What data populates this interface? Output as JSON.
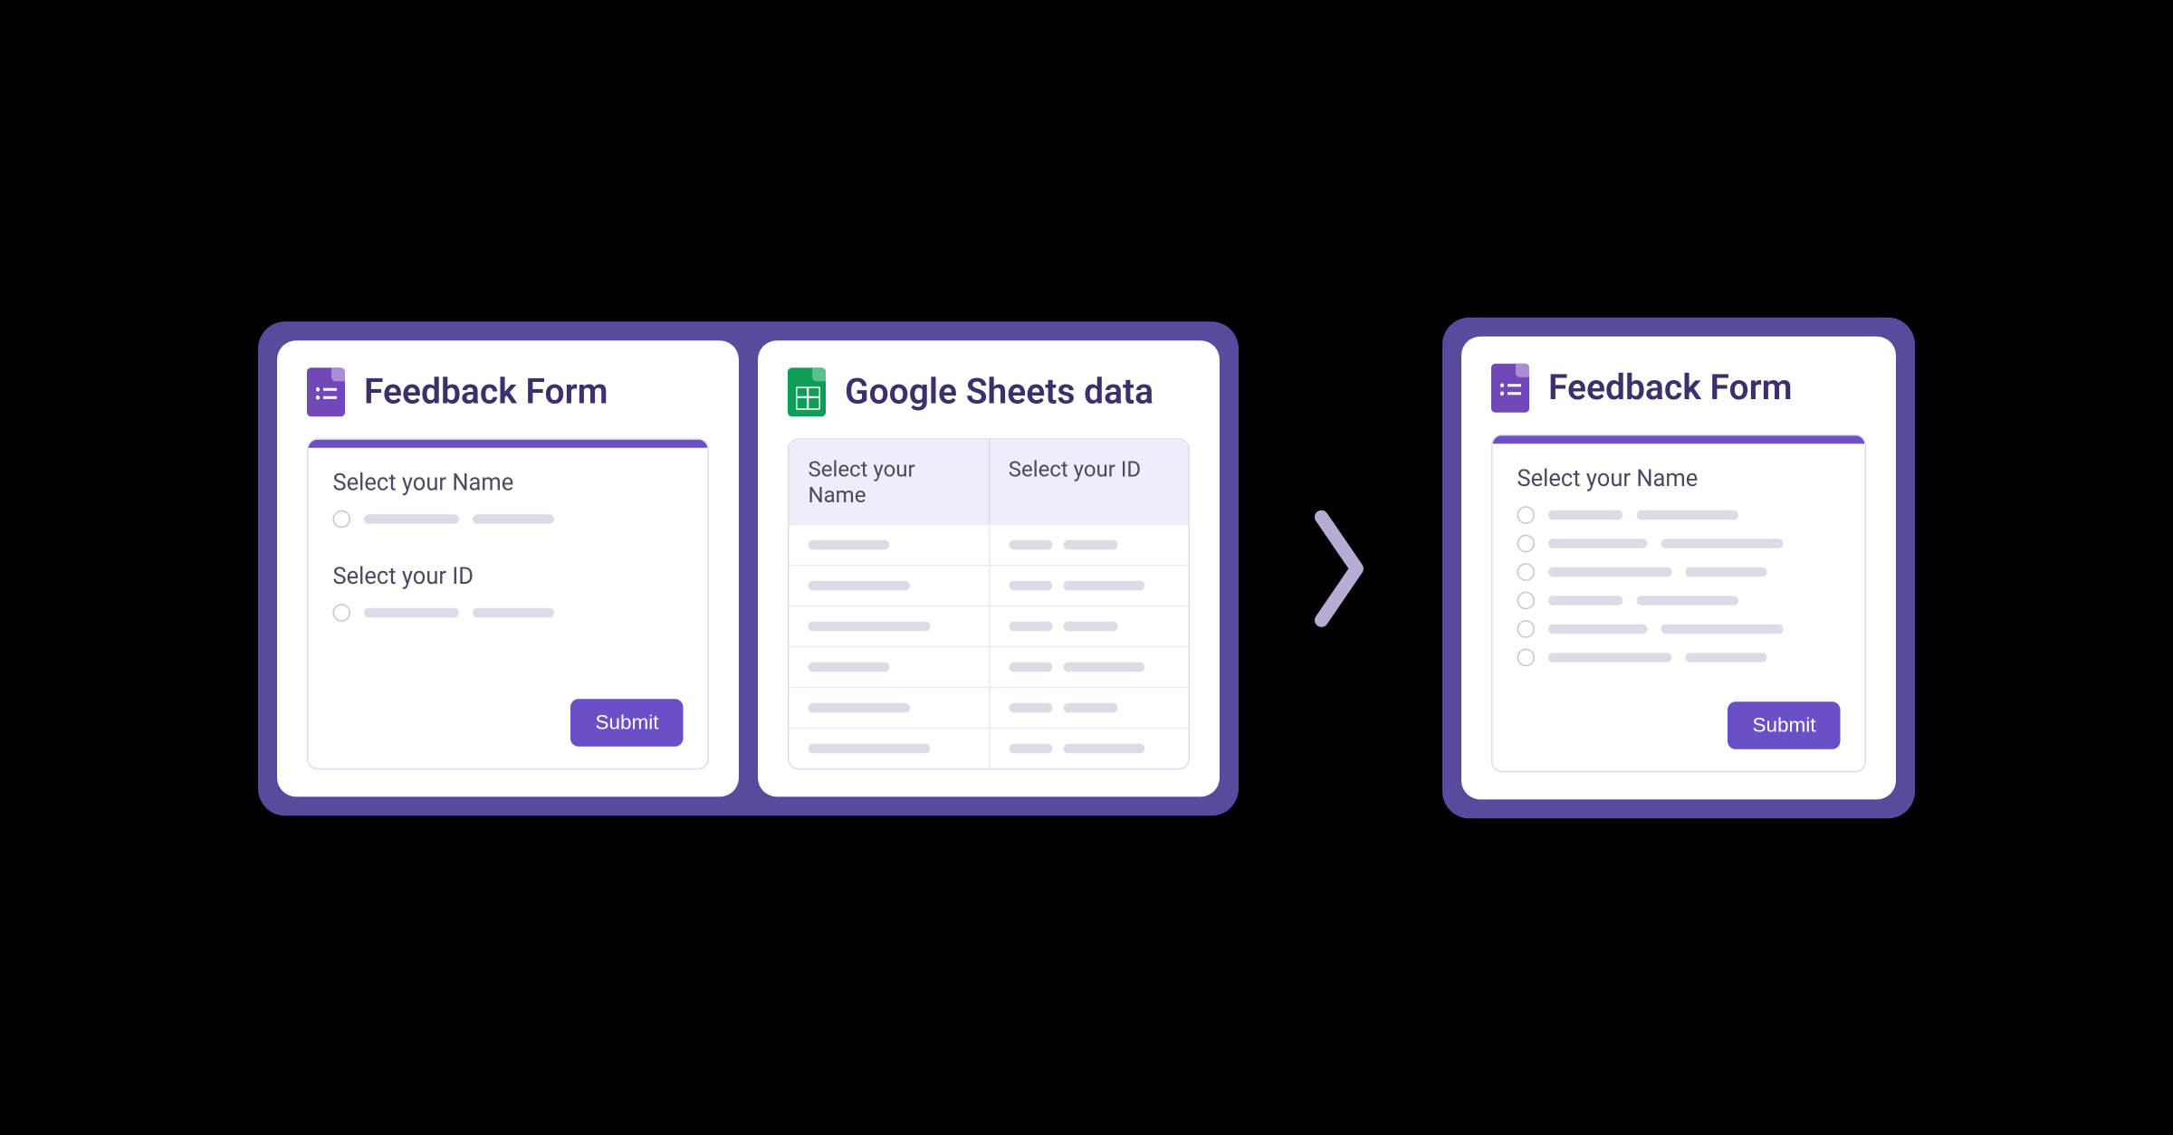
{
  "left_form": {
    "title": "Feedback Form",
    "questions": [
      {
        "label": "Select your Name",
        "option_count": 1
      },
      {
        "label": "Select your ID",
        "option_count": 1
      }
    ],
    "submit_label": "Submit"
  },
  "sheets": {
    "title": "Google Sheets data",
    "headers": [
      "Select your Name",
      "Select your ID"
    ],
    "row_count": 6
  },
  "right_form": {
    "title": "Feedback Form",
    "questions": [
      {
        "label": "Select your Name",
        "option_count": 6
      }
    ],
    "submit_label": "Submit"
  }
}
